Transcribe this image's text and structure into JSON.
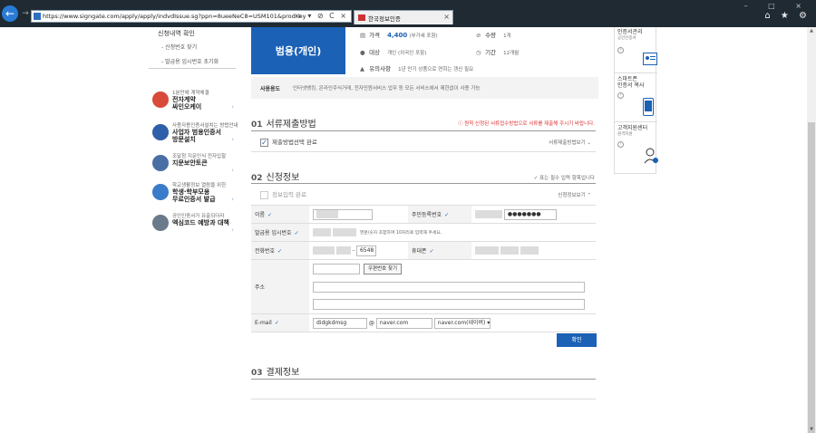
{
  "browser": {
    "url": "https://www.signgate.com/apply/apply/indvdIssue.sg?ppn=8ueeNeC8=USM101&prodKey=%7B%22prodId%22%3A%2234defc5",
    "tab_title": "한국정보인증",
    "tab_close": "×",
    "window_buttons": "– □ ×",
    "tool_icons": "⌂ ★ ⚙",
    "addr_icons": "⌕ ▾ ⊘ C ×"
  },
  "sidebar_left": {
    "link_confirm": "신청내역 확인",
    "link_find_no": "- 신청번호 찾기",
    "link_reset_pw": "- 발급용 임시번호 초기화",
    "banners": [
      {
        "small": "1분만에 계약체결",
        "big": "전자계약\n싸인오케이",
        "color": "#d84a3a"
      },
      {
        "small": "사용자용인증서설치는 방법안내",
        "big": "사업자 범용인증서\n방문설치",
        "color": "#2e5fa8"
      },
      {
        "small": "조달청 지문인식 전자입찰",
        "big": "지문보안토큰",
        "color": "#4a6fa5"
      },
      {
        "small": "학교생활정보 열람을 위한",
        "big": "학생·학부모용\n무료인증서 발급",
        "color": "#3a7cc9"
      },
      {
        "small": "공인인증서가 유출되더라",
        "big": "엑심코드 예방과 대책",
        "color": "#6a7a8a"
      }
    ],
    "arrow": "›"
  },
  "product": {
    "name": "범용(개인)",
    "price_label": "가격",
    "price_value": "4,400",
    "price_note": "(부가세 포함)",
    "count_label": "수량",
    "count_value": "1개",
    "target_label": "대상",
    "target_value": "개인 (외국인 포함)",
    "period_label": "기간",
    "period_value": "12개월",
    "notice_label": "유의사항",
    "notice_link": "1년 만기 상품으로 연회는 갱신 필요"
  },
  "usage": {
    "label": "사용용도",
    "text": "인터넷뱅킹, 온라인주식거래, 전자민원서비스 업무 등 모든 서비스에서 제한없이 사용 가능"
  },
  "section1": {
    "num": "01",
    "title": "서류제출방법",
    "warning": "ⓘ 원칙 신청된 서류접수방법으로 서류를 제출해 주시기 바랍니다.",
    "done_label": "제출방법선택 완료",
    "fold_label": "서류제출방법보기"
  },
  "section2": {
    "num": "02",
    "title": "신청정보",
    "required_note": "✓ 표는 필수 입력 항목입니다",
    "done_label": "정보입력 완료",
    "fold_label": "신청정보보기"
  },
  "form": {
    "name_label": "이름",
    "rrn_label": "주민등록번호",
    "rrn_masked": "●●●●●●●",
    "temp_no_label": "발급용 임시번호",
    "temp_no_hint": "영문/숫자 조합하여 10자리로 입력해 주세요.",
    "phone_label": "전화번호",
    "phone_tail": "6548",
    "mobile_label": "휴대폰",
    "zip_button": "우편번호 찾기",
    "address_label": "주소",
    "email_label": "E-mail",
    "email_id": "didgkdmsg",
    "email_at": "@",
    "email_domain": "naver.com",
    "email_select": "naver.com(네이버)",
    "check": "✓",
    "dash": "-",
    "confirm_button": "확인"
  },
  "section3": {
    "num": "03",
    "title": "결제정보"
  },
  "sidebar_right": {
    "items": [
      {
        "title": "인증서관리",
        "sub": "공인인증서"
      },
      {
        "title": "스마트폰\n인증서 복사",
        "sub": ""
      },
      {
        "title": "고객지원센터",
        "sub": "원격지원"
      }
    ],
    "arrow": "›"
  },
  "scrollbar": {
    "up": "▲",
    "down": "▼"
  }
}
